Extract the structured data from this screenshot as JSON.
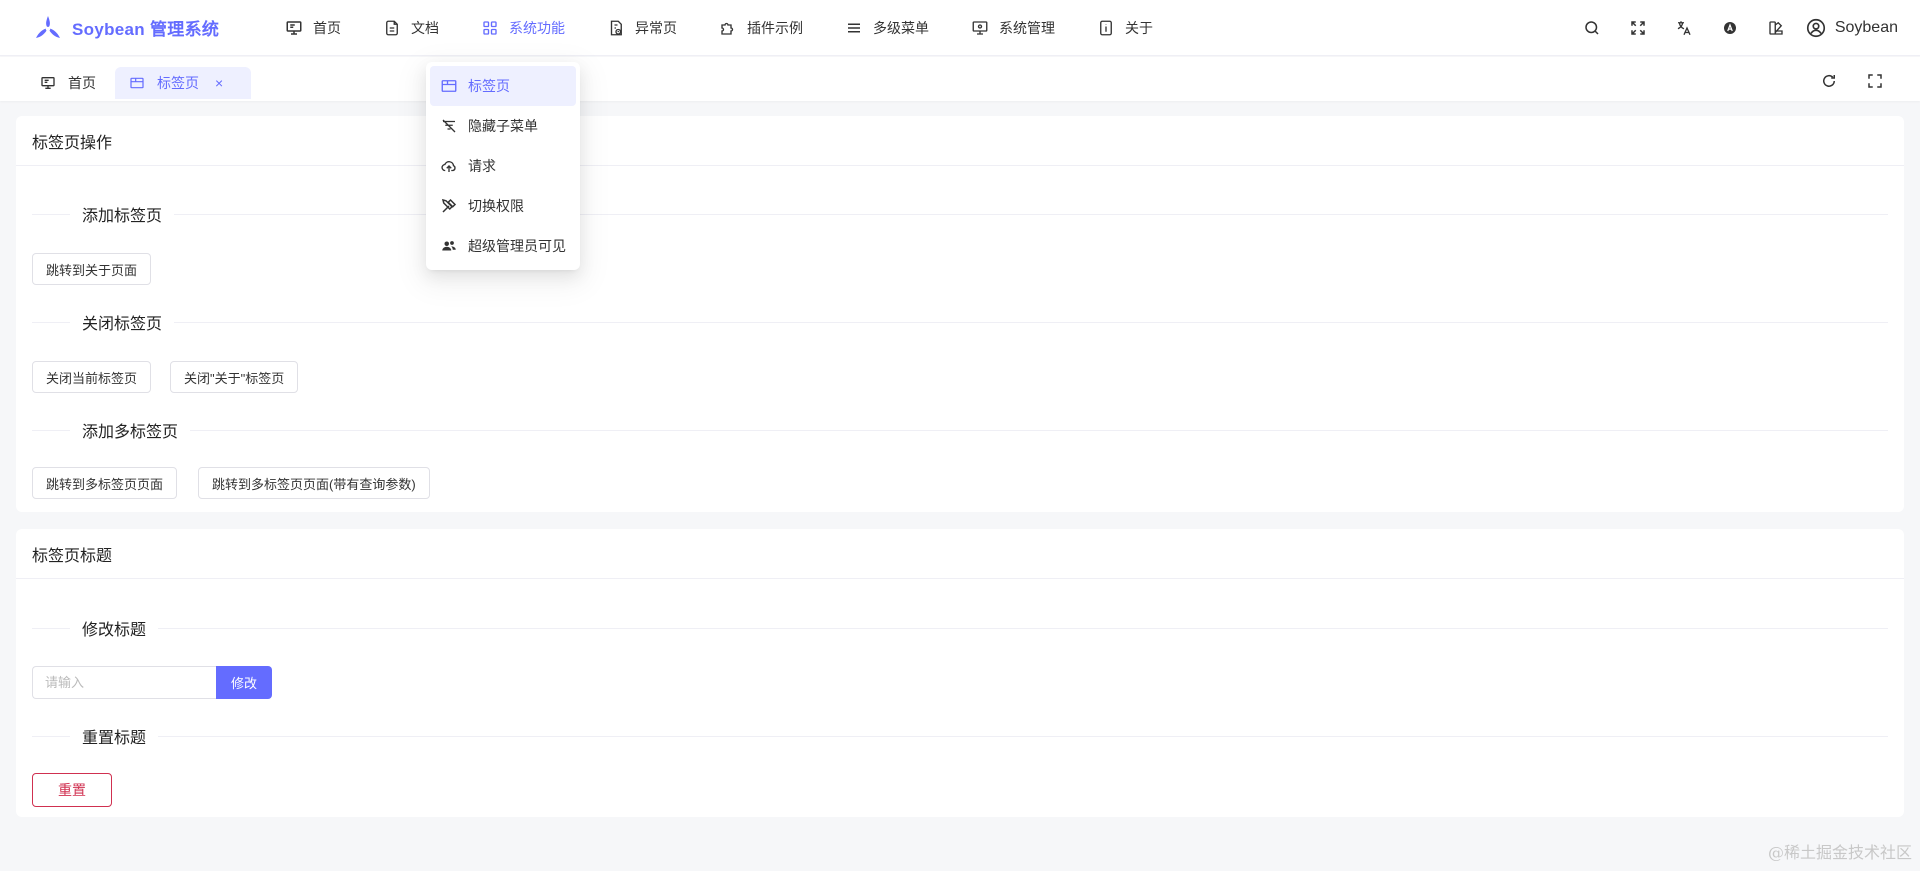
{
  "app": {
    "title": "Soybean 管理系统",
    "accent": "#646cff"
  },
  "topmenu": [
    {
      "label": "首页",
      "icon": "monitor-icon"
    },
    {
      "label": "文档",
      "icon": "document-icon"
    },
    {
      "label": "系统功能",
      "icon": "grid-icon",
      "active": true
    },
    {
      "label": "异常页",
      "icon": "file-warning-icon"
    },
    {
      "label": "插件示例",
      "icon": "puzzle-icon"
    },
    {
      "label": "多级菜单",
      "icon": "menu-icon"
    },
    {
      "label": "系统管理",
      "icon": "monitor-settings-icon"
    },
    {
      "label": "关于",
      "icon": "info-icon"
    }
  ],
  "header_actions": [
    "search-icon",
    "fullscreen-icon",
    "translate-icon",
    "theme-icon",
    "color-icon"
  ],
  "user": {
    "name": "Soybean"
  },
  "tabs": [
    {
      "label": "首页",
      "icon": "monitor-icon"
    },
    {
      "label": "标签页",
      "icon": "tab-icon",
      "active": true,
      "close": "×"
    }
  ],
  "dropdown": [
    {
      "label": "标签页",
      "icon": "tab-icon",
      "active": true
    },
    {
      "label": "隐藏子菜单",
      "icon": "filter-off-icon"
    },
    {
      "label": "请求",
      "icon": "cloud-upload-icon"
    },
    {
      "label": "切换权限",
      "icon": "tools-icon"
    },
    {
      "label": "超级管理员可见",
      "icon": "users-icon"
    }
  ],
  "card1": {
    "title": "标签页操作",
    "sections": {
      "add": {
        "label": "添加标签页",
        "button": "跳转到关于页面"
      },
      "close": {
        "label": "关闭标签页",
        "button1": "关闭当前标签页",
        "button2": "关闭\"关于\"标签页"
      },
      "multi": {
        "label": "添加多标签页",
        "button1": "跳转到多标签页页面",
        "button2": "跳转到多标签页页面(带有查询参数)"
      }
    }
  },
  "card2": {
    "title": "标签页标题",
    "sections": {
      "edit": {
        "label": "修改标题",
        "placeholder": "请输入",
        "button": "修改"
      },
      "reset": {
        "label": "重置标题",
        "button": "重置"
      }
    }
  },
  "watermark": "@稀土掘金技术社区"
}
